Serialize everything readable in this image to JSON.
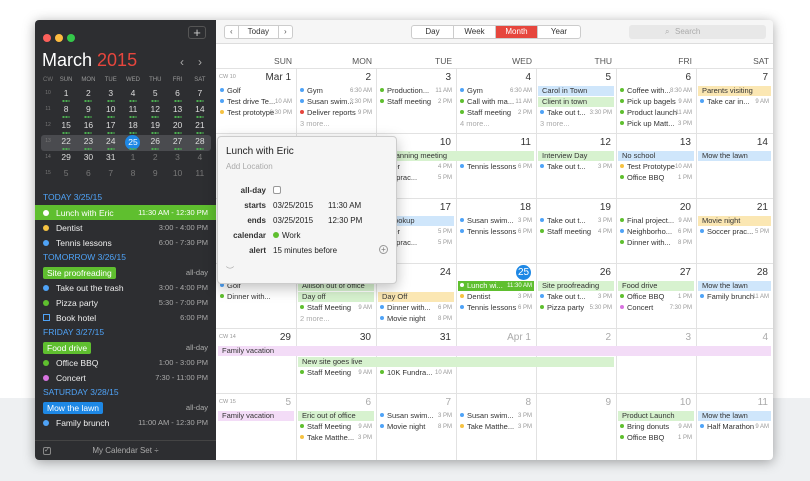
{
  "sidebar": {
    "add_label": "+",
    "month": "March",
    "year": "2015",
    "prev": "‹",
    "next": "›",
    "weekday_headers": [
      "CW",
      "SUN",
      "MON",
      "TUE",
      "WED",
      "THU",
      "FRI",
      "SAT"
    ],
    "mini_weeks": [
      [
        "10",
        "1",
        "2",
        "3",
        "4",
        "5",
        "6",
        "7"
      ],
      [
        "11",
        "8",
        "9",
        "10",
        "11",
        "12",
        "13",
        "14"
      ],
      [
        "12",
        "15",
        "16",
        "17",
        "18",
        "19",
        "20",
        "21"
      ],
      [
        "13",
        "22",
        "23",
        "24",
        "25",
        "26",
        "27",
        "28"
      ],
      [
        "14",
        "29",
        "30",
        "31",
        "1",
        "2",
        "3",
        "4"
      ],
      [
        "15",
        "5",
        "6",
        "7",
        "8",
        "9",
        "10",
        "11"
      ]
    ],
    "agenda": [
      {
        "kind": "header",
        "text": "TODAY 3/25/15"
      },
      {
        "kind": "item",
        "title": "Lunch with Eric",
        "time": "11:30 AM - 12:30 PM",
        "color": "#5fbf2f",
        "selected": true
      },
      {
        "kind": "item",
        "title": "Dentist",
        "time": "3:00 - 4:00 PM",
        "color": "#f5c242"
      },
      {
        "kind": "item",
        "title": "Tennis lessons",
        "time": "6:00 - 7:30 PM",
        "color": "#4fa3f7"
      },
      {
        "kind": "header",
        "text": "TOMORROW 3/26/15"
      },
      {
        "kind": "tag",
        "title": "Site proofreading",
        "time": "all-day",
        "color": "#5fbf2f"
      },
      {
        "kind": "item",
        "title": "Take out the trash",
        "time": "3:00 - 4:00 PM",
        "color": "#4fa3f7"
      },
      {
        "kind": "item",
        "title": "Pizza party",
        "time": "5:30 - 7:00 PM",
        "color": "#5fbf2f"
      },
      {
        "kind": "box",
        "title": "Book hotel",
        "time": "6:00 PM",
        "color": "#4fa3f7"
      },
      {
        "kind": "header",
        "text": "FRIDAY 3/27/15"
      },
      {
        "kind": "tag",
        "title": "Food drive",
        "time": "all-day",
        "color": "#5fbf2f"
      },
      {
        "kind": "item",
        "title": "Office BBQ",
        "time": "1:00 - 3:00 PM",
        "color": "#5fbf2f"
      },
      {
        "kind": "item",
        "title": "Concert",
        "time": "7:30 - 11:00 PM",
        "color": "#d874e0"
      },
      {
        "kind": "header",
        "text": "SATURDAY 3/28/15"
      },
      {
        "kind": "tag",
        "title": "Mow the lawn",
        "time": "all-day",
        "color": "#1e88e5"
      },
      {
        "kind": "item",
        "title": "Family brunch",
        "time": "11:00 AM - 12:30 PM",
        "color": "#4fa3f7"
      }
    ],
    "footer": "My Calendar Set ÷"
  },
  "toolbar": {
    "today": "Today",
    "prev": "‹",
    "next": "›",
    "views": [
      "Day",
      "Week",
      "Month",
      "Year"
    ],
    "active_view": "Month",
    "search_placeholder": "Search"
  },
  "month": {
    "day_headers": [
      "SUN",
      "MON",
      "TUE",
      "WED",
      "THU",
      "FRI",
      "SAT"
    ],
    "weeks": [
      {
        "cw": "CW 10",
        "days": [
          "Mar 1",
          "2",
          "3",
          "4",
          "5",
          "6",
          "7"
        ],
        "dim": [
          false,
          false,
          false,
          false,
          false,
          false,
          false
        ]
      },
      {
        "cw": "",
        "days": [
          "8",
          "9",
          "10",
          "11",
          "12",
          "13",
          "14"
        ],
        "dim": [
          false,
          false,
          false,
          false,
          false,
          false,
          false
        ]
      },
      {
        "cw": "",
        "days": [
          "15",
          "16",
          "17",
          "18",
          "19",
          "20",
          "21"
        ],
        "dim": [
          false,
          false,
          false,
          false,
          false,
          false,
          false
        ]
      },
      {
        "cw": "",
        "days": [
          "22",
          "23",
          "24",
          "25",
          "26",
          "27",
          "28"
        ],
        "dim": [
          false,
          false,
          false,
          false,
          false,
          false,
          false
        ]
      },
      {
        "cw": "CW 14",
        "days": [
          "29",
          "30",
          "31",
          "Apr 1",
          "2",
          "3",
          "4"
        ],
        "dim": [
          false,
          false,
          false,
          true,
          true,
          true,
          true
        ]
      },
      {
        "cw": "CW 15",
        "days": [
          "5",
          "6",
          "7",
          "8",
          "9",
          "10",
          "11"
        ],
        "dim": [
          true,
          true,
          true,
          true,
          true,
          true,
          true
        ]
      }
    ],
    "events": [
      {
        "w": 0,
        "d": 0,
        "r": 0,
        "t": "Golf",
        "tm": "",
        "c": "#4fa3f7"
      },
      {
        "w": 0,
        "d": 0,
        "r": 1,
        "t": "Test drive Te...",
        "tm": "10 AM",
        "c": "#4fa3f7"
      },
      {
        "w": 0,
        "d": 0,
        "r": 2,
        "t": "Test prototype",
        "tm": "6:30 PM",
        "c": "#f5c242"
      },
      {
        "w": 0,
        "d": 1,
        "r": 0,
        "t": "Gym",
        "tm": "6:30 AM",
        "c": "#4fa3f7"
      },
      {
        "w": 0,
        "d": 1,
        "r": 1,
        "t": "Susan swim...",
        "tm": "3:30 PM",
        "c": "#4fa3f7"
      },
      {
        "w": 0,
        "d": 1,
        "r": 2,
        "t": "Deliver reports",
        "tm": "9 PM",
        "c": "#e6463d"
      },
      {
        "w": 0,
        "d": 1,
        "r": 3,
        "t": "3 more...",
        "tm": "",
        "c": "",
        "more": true
      },
      {
        "w": 0,
        "d": 2,
        "r": 0,
        "t": "Production...",
        "tm": "11 AM",
        "c": "#5fbf2f"
      },
      {
        "w": 0,
        "d": 2,
        "r": 1,
        "t": "Staff meeting",
        "tm": "2 PM",
        "c": "#5fbf2f"
      },
      {
        "w": 0,
        "d": 3,
        "r": 0,
        "t": "Gym",
        "tm": "6:30 AM",
        "c": "#4fa3f7"
      },
      {
        "w": 0,
        "d": 3,
        "r": 1,
        "t": "Call with ma...",
        "tm": "11 AM",
        "c": "#5fbf2f"
      },
      {
        "w": 0,
        "d": 3,
        "r": 2,
        "t": "Staff meeting",
        "tm": "2 PM",
        "c": "#5fbf2f"
      },
      {
        "w": 0,
        "d": 3,
        "r": 3,
        "t": "4 more...",
        "tm": "",
        "c": "",
        "more": true
      },
      {
        "w": 0,
        "d": 4,
        "r": 0,
        "t": "Carol in Town",
        "tm": "",
        "c": "#cfe6fb",
        "bar": true
      },
      {
        "w": 0,
        "d": 4,
        "r": 1,
        "t": "Client in town",
        "tm": "",
        "c": "#d7f2cf",
        "bar": true
      },
      {
        "w": 0,
        "d": 4,
        "r": 2,
        "t": "Take out t...",
        "tm": "3:30 PM",
        "c": "#4fa3f7"
      },
      {
        "w": 0,
        "d": 4,
        "r": 3,
        "t": "3 more...",
        "tm": "",
        "c": "",
        "more": true
      },
      {
        "w": 0,
        "d": 5,
        "r": 0,
        "t": "Coffee with...",
        "tm": "8:30 AM",
        "c": "#5fbf2f"
      },
      {
        "w": 0,
        "d": 5,
        "r": 1,
        "t": "Pick up bagels",
        "tm": "9 AM",
        "c": "#5fbf2f"
      },
      {
        "w": 0,
        "d": 5,
        "r": 2,
        "t": "Product launch",
        "tm": "11 AM",
        "c": "#5fbf2f"
      },
      {
        "w": 0,
        "d": 5,
        "r": 3,
        "t": "Pick up Matt...",
        "tm": "3 PM",
        "c": "#5fbf2f"
      },
      {
        "w": 0,
        "d": 6,
        "r": 0,
        "t": "Parents visiting",
        "tm": "",
        "c": "#fbe7b3",
        "bar": true
      },
      {
        "w": 0,
        "d": 6,
        "r": 1,
        "t": "Take car in...",
        "tm": "9 AM",
        "c": "#4fa3f7"
      },
      {
        "w": 1,
        "d": 2,
        "r": 0,
        "t": "al planning meeting",
        "tm": "",
        "c": "#d7f2cf",
        "bar": true,
        "span": 2
      },
      {
        "w": 1,
        "d": 2,
        "r": 1,
        "t": "ysitter",
        "tm": "4 PM",
        "c": ""
      },
      {
        "w": 1,
        "d": 2,
        "r": 2,
        "t": "ccer prac...",
        "tm": "5 PM",
        "c": ""
      },
      {
        "w": 1,
        "d": 3,
        "r": 1,
        "t": "Tennis lessons",
        "tm": "6 PM",
        "c": "#4fa3f7"
      },
      {
        "w": 1,
        "d": 4,
        "r": 0,
        "t": "Interview Day",
        "tm": "",
        "c": "#d7f2cf",
        "bar": true
      },
      {
        "w": 1,
        "d": 4,
        "r": 1,
        "t": "Take out t...",
        "tm": "3 PM",
        "c": "#4fa3f7"
      },
      {
        "w": 1,
        "d": 5,
        "r": 0,
        "t": "No school",
        "tm": "",
        "c": "#cfe6fb",
        "bar": true
      },
      {
        "w": 1,
        "d": 5,
        "r": 1,
        "t": "Test Prototype",
        "tm": "10 AM",
        "c": "#f5c242"
      },
      {
        "w": 1,
        "d": 5,
        "r": 2,
        "t": "Office BBQ",
        "tm": "1 PM",
        "c": "#5fbf2f"
      },
      {
        "w": 1,
        "d": 6,
        "r": 0,
        "t": "Mow the lawn",
        "tm": "",
        "c": "#cfe6fb",
        "bar": true
      },
      {
        "w": 2,
        "d": 2,
        "r": 0,
        "t": "le hookup",
        "tm": "",
        "c": "#cfe6fb",
        "bar": true
      },
      {
        "w": 2,
        "d": 2,
        "r": 1,
        "t": "ysitter",
        "tm": "5 PM",
        "c": ""
      },
      {
        "w": 2,
        "d": 2,
        "r": 2,
        "t": "ccer prac...",
        "tm": "5 PM",
        "c": ""
      },
      {
        "w": 2,
        "d": 3,
        "r": 0,
        "t": "Susan swim...",
        "tm": "3 PM",
        "c": "#4fa3f7"
      },
      {
        "w": 2,
        "d": 3,
        "r": 1,
        "t": "Tennis lessons",
        "tm": "6 PM",
        "c": "#4fa3f7"
      },
      {
        "w": 2,
        "d": 4,
        "r": 0,
        "t": "Take out t...",
        "tm": "3 PM",
        "c": "#4fa3f7"
      },
      {
        "w": 2,
        "d": 4,
        "r": 1,
        "t": "Staff meeting",
        "tm": "4 PM",
        "c": "#5fbf2f"
      },
      {
        "w": 2,
        "d": 5,
        "r": 0,
        "t": "Final project...",
        "tm": "9 AM",
        "c": "#5fbf2f"
      },
      {
        "w": 2,
        "d": 5,
        "r": 1,
        "t": "Neighborho...",
        "tm": "6 PM",
        "c": "#4fa3f7"
      },
      {
        "w": 2,
        "d": 5,
        "r": 2,
        "t": "Dinner with...",
        "tm": "8 PM",
        "c": "#5fbf2f"
      },
      {
        "w": 2,
        "d": 6,
        "r": 0,
        "t": "Movie night",
        "tm": "",
        "c": "#fbe7b3",
        "bar": true
      },
      {
        "w": 2,
        "d": 6,
        "r": 1,
        "t": "Soccer prac...",
        "tm": "5 PM",
        "c": "#4fa3f7"
      },
      {
        "w": 3,
        "d": 0,
        "r": 0,
        "t": "Golf",
        "tm": "",
        "c": "#4fa3f7"
      },
      {
        "w": 3,
        "d": 0,
        "r": 1,
        "t": "Dinner with...",
        "tm": "",
        "c": "#5fbf2f"
      },
      {
        "w": 3,
        "d": 1,
        "r": 0,
        "t": "Allison out of office",
        "tm": "",
        "c": "#d7f2cf",
        "bar": true
      },
      {
        "w": 3,
        "d": 1,
        "r": 1,
        "t": "Day off",
        "tm": "",
        "c": "#d7f2cf",
        "bar": true
      },
      {
        "w": 3,
        "d": 1,
        "r": 2,
        "t": "Staff Meeting",
        "tm": "9 AM",
        "c": "#5fbf2f"
      },
      {
        "w": 3,
        "d": 1,
        "r": 3,
        "t": "2 more...",
        "tm": "",
        "c": "",
        "more": true
      },
      {
        "w": 3,
        "d": 2,
        "r": 1,
        "t": "Day Off",
        "tm": "",
        "c": "#fbe7b3",
        "bar": true
      },
      {
        "w": 3,
        "d": 2,
        "r": 2,
        "t": "Dinner with...",
        "tm": "6 PM",
        "c": "#4fa3f7"
      },
      {
        "w": 3,
        "d": 2,
        "r": 3,
        "t": "Movie night",
        "tm": "8 PM",
        "c": "#4fa3f7"
      },
      {
        "w": 3,
        "d": 3,
        "r": 0,
        "t": "Lunch wi...",
        "tm": "11:30 AM",
        "c": "#5fbf2f",
        "sel": true
      },
      {
        "w": 3,
        "d": 3,
        "r": 1,
        "t": "Dentist",
        "tm": "3 PM",
        "c": "#f5c242"
      },
      {
        "w": 3,
        "d": 3,
        "r": 2,
        "t": "Tennis lessons",
        "tm": "6 PM",
        "c": "#4fa3f7"
      },
      {
        "w": 3,
        "d": 4,
        "r": 0,
        "t": "Site proofreading",
        "tm": "",
        "c": "#d7f2cf",
        "bar": true
      },
      {
        "w": 3,
        "d": 4,
        "r": 1,
        "t": "Take out t...",
        "tm": "3 PM",
        "c": "#4fa3f7"
      },
      {
        "w": 3,
        "d": 4,
        "r": 2,
        "t": "Pizza party",
        "tm": "5:30 PM",
        "c": "#5fbf2f"
      },
      {
        "w": 3,
        "d": 5,
        "r": 0,
        "t": "Food drive",
        "tm": "",
        "c": "#d7f2cf",
        "bar": true
      },
      {
        "w": 3,
        "d": 5,
        "r": 1,
        "t": "Office BBQ",
        "tm": "1 PM",
        "c": "#5fbf2f"
      },
      {
        "w": 3,
        "d": 5,
        "r": 2,
        "t": "Concert",
        "tm": "7:30 PM",
        "c": "#d874e0"
      },
      {
        "w": 3,
        "d": 6,
        "r": 0,
        "t": "Mow the lawn",
        "tm": "",
        "c": "#cfe6fb",
        "bar": true
      },
      {
        "w": 3,
        "d": 6,
        "r": 1,
        "t": "Family brunch",
        "tm": "11 AM",
        "c": "#4fa3f7"
      },
      {
        "w": 4,
        "d": 0,
        "r": 0,
        "t": "Family vacation",
        "tm": "",
        "c": "#f3dcf7",
        "bar": true,
        "span": 7
      },
      {
        "w": 4,
        "d": 1,
        "r": 1,
        "t": "New site goes live",
        "tm": "",
        "c": "#d7f2cf",
        "bar": true,
        "span": 4
      },
      {
        "w": 4,
        "d": 1,
        "r": 2,
        "t": "Staff Meeting",
        "tm": "9 AM",
        "c": "#5fbf2f"
      },
      {
        "w": 4,
        "d": 2,
        "r": 2,
        "t": "10K Fundra...",
        "tm": "10 AM",
        "c": "#5fbf2f"
      },
      {
        "w": 5,
        "d": 0,
        "r": 0,
        "t": "Family vacation",
        "tm": "",
        "c": "#f3dcf7",
        "bar": true
      },
      {
        "w": 5,
        "d": 1,
        "r": 0,
        "t": "Eric out of office",
        "tm": "",
        "c": "#d7f2cf",
        "bar": true
      },
      {
        "w": 5,
        "d": 1,
        "r": 1,
        "t": "Staff Meeting",
        "tm": "9 AM",
        "c": "#5fbf2f"
      },
      {
        "w": 5,
        "d": 1,
        "r": 2,
        "t": "Take Matthe...",
        "tm": "3 PM",
        "c": "#f5c242"
      },
      {
        "w": 5,
        "d": 2,
        "r": 0,
        "t": "Susan swim...",
        "tm": "3 PM",
        "c": "#4fa3f7"
      },
      {
        "w": 5,
        "d": 2,
        "r": 1,
        "t": "Movie night",
        "tm": "8 PM",
        "c": "#4fa3f7"
      },
      {
        "w": 5,
        "d": 3,
        "r": 0,
        "t": "Susan swim...",
        "tm": "3 PM",
        "c": "#4fa3f7"
      },
      {
        "w": 5,
        "d": 3,
        "r": 1,
        "t": "Take Matthe...",
        "tm": "3 PM",
        "c": "#f5c242"
      },
      {
        "w": 5,
        "d": 5,
        "r": 0,
        "t": "Product Launch",
        "tm": "",
        "c": "#d7f2cf",
        "bar": true
      },
      {
        "w": 5,
        "d": 5,
        "r": 1,
        "t": "Bring donuts",
        "tm": "9 AM",
        "c": "#5fbf2f"
      },
      {
        "w": 5,
        "d": 5,
        "r": 2,
        "t": "Office BBQ",
        "tm": "1 PM",
        "c": "#5fbf2f"
      },
      {
        "w": 5,
        "d": 6,
        "r": 0,
        "t": "Mow the lawn",
        "tm": "",
        "c": "#cfe6fb",
        "bar": true
      },
      {
        "w": 5,
        "d": 6,
        "r": 1,
        "t": "Half Marathon",
        "tm": "9 AM",
        "c": "#4fa3f7"
      }
    ]
  },
  "popover": {
    "title": "Lunch with Eric",
    "location_placeholder": "Add Location",
    "allday_label": "all-day",
    "starts_label": "starts",
    "starts_date": "03/25/2015",
    "starts_time": "11:30 AM",
    "ends_label": "ends",
    "ends_date": "03/25/2015",
    "ends_time": "12:30 PM",
    "calendar_label": "calendar",
    "calendar_value": "Work",
    "calendar_color": "#5fbf2f",
    "alert_label": "alert",
    "alert_value": "15 minutes before",
    "add_alert": "+"
  },
  "colors": {
    "accent": "#e6463d",
    "today": "#1e88e5",
    "sidebar_bg": "#2d2e31"
  }
}
